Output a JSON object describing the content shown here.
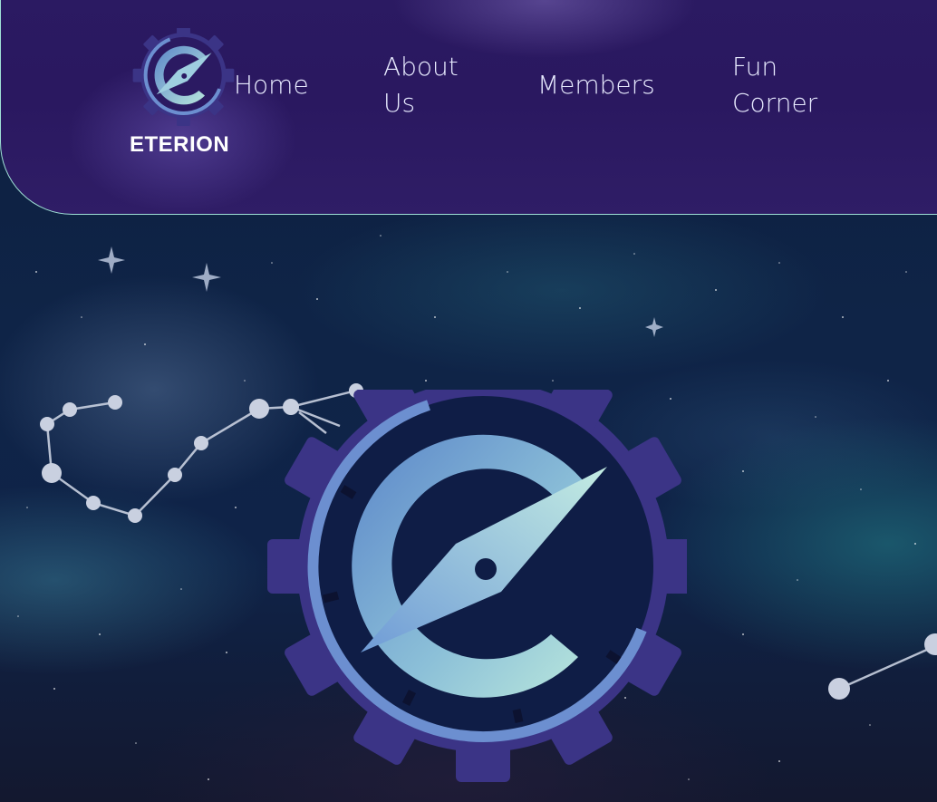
{
  "brand": {
    "name": "ETERION",
    "logo_icon": "gear-compass-logo-icon"
  },
  "nav": {
    "items": [
      {
        "label": "Home"
      },
      {
        "label": "About Us"
      },
      {
        "label": "Members"
      },
      {
        "label": "Fun Corner"
      }
    ]
  },
  "hero": {
    "logo_icon": "gear-compass-emblem-icon",
    "decorations": [
      "constellation-left",
      "constellation-right",
      "sparkle-stars"
    ]
  },
  "colors": {
    "header_bg": "#2b1a62",
    "header_border": "#9fe0d6",
    "space_bg": "#0f2447",
    "gear": "#3b3486",
    "ring": "#6c8fd0",
    "c_gradient_start": "#b8e6dc",
    "c_gradient_end": "#5b86c9",
    "nav_text": "#e8ebff"
  }
}
